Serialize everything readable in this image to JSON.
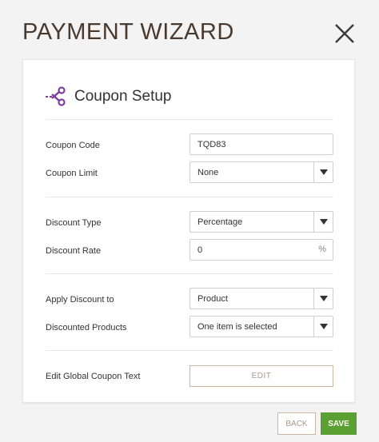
{
  "header": {
    "title": "PAYMENT WIZARD"
  },
  "card": {
    "title": "Coupon Setup"
  },
  "fields": {
    "coupon_code": {
      "label": "Coupon Code",
      "value": "TQD83"
    },
    "coupon_limit": {
      "label": "Coupon Limit",
      "value": "None"
    },
    "discount_type": {
      "label": "Discount Type",
      "value": "Percentage"
    },
    "discount_rate": {
      "label": "Discount Rate",
      "value": "0",
      "suffix": "%"
    },
    "apply_discount_to": {
      "label": "Apply Discount to",
      "value": "Product"
    },
    "discounted_products": {
      "label": "Discounted Products",
      "value": "One item is selected"
    },
    "edit_global_text": {
      "label": "Edit Global Coupon Text",
      "button": "EDIT"
    }
  },
  "footer": {
    "back_label": "BACK",
    "save_label": "SAVE"
  },
  "colors": {
    "accent": "#7b3fa0",
    "save": "#5aa032",
    "title": "#4a3a2e"
  },
  "icons": {
    "close": "close-icon",
    "coupon": "scissors-icon"
  }
}
